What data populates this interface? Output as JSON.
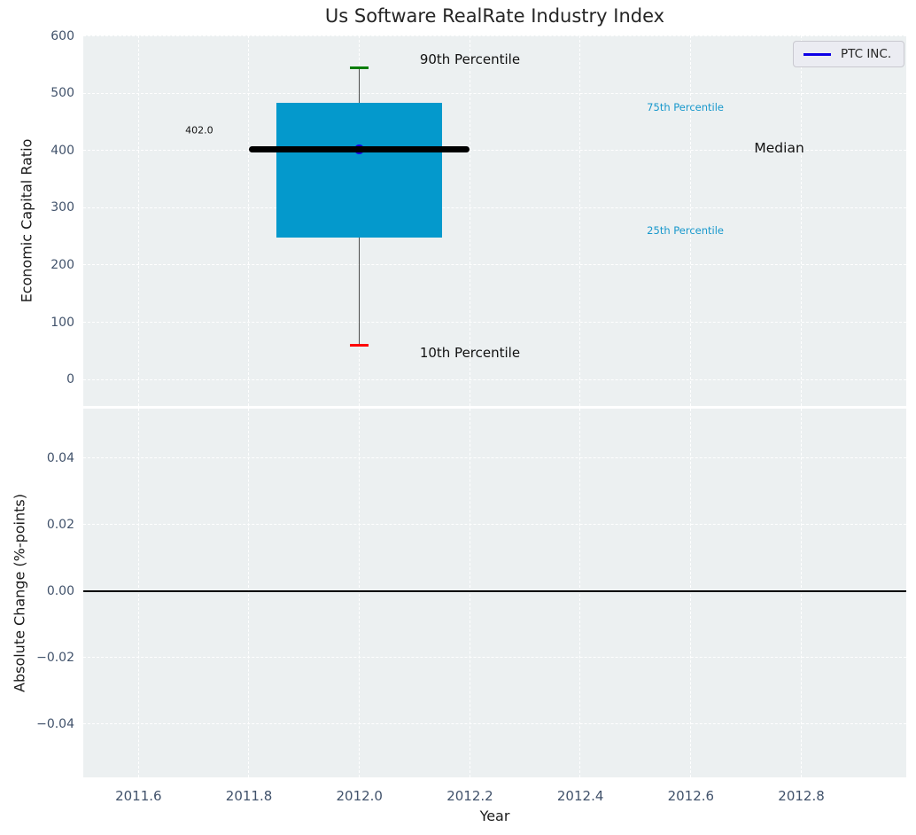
{
  "figure": {
    "title": "Us Software RealRate Industry Index",
    "xlabel": "Year",
    "legend": {
      "entries": [
        {
          "label": "PTC INC.",
          "line_color": "#0d00e6"
        }
      ]
    }
  },
  "colors": {
    "plot_background": "#ecf0f1",
    "gridline": "#ffffff",
    "box_fill": "#0499cc",
    "median_line": "#000000",
    "whisker": "#4d4d4d",
    "upper_cap": "#007d00",
    "lower_cap": "#fe0000",
    "company_marker": "#1500e0",
    "tick_label": "#41526b",
    "axis_label": "#1a1a1a",
    "zero_line": "#000000",
    "percentile_label_blue": "#1898cc",
    "annotation_black": "#111111"
  },
  "chart_data": [
    {
      "type": "box",
      "title": "Us Software RealRate Industry Index",
      "ylabel": "Economic Capital Ratio",
      "xlabel": "Year",
      "xlim": [
        2011.5,
        2012.99
      ],
      "ylim": [
        -46,
        601
      ],
      "grid": true,
      "legend_position": "upper right",
      "box": {
        "x": 2012.0,
        "p10": 60,
        "p25": 248,
        "median": 402,
        "p75": 483,
        "p90": 545,
        "box_half_width": 0.15,
        "median_half_width": 0.2,
        "cap_half_width": 0.017
      },
      "series": [
        {
          "name": "PTC INC.",
          "x": [
            2012.0
          ],
          "values": [
            402
          ]
        }
      ],
      "yticks": [
        {
          "v": 0,
          "label": "0"
        },
        {
          "v": 100,
          "label": "100"
        },
        {
          "v": 200,
          "label": "200"
        },
        {
          "v": 300,
          "label": "300"
        },
        {
          "v": 400,
          "label": "400"
        },
        {
          "v": 500,
          "label": "500"
        },
        {
          "v": 600,
          "label": "600"
        }
      ],
      "xticks": [
        {
          "v": 2011.6,
          "label": "2011.6"
        },
        {
          "v": 2011.8,
          "label": "2011.8"
        },
        {
          "v": 2012.0,
          "label": "2012.0"
        },
        {
          "v": 2012.2,
          "label": "2012.2"
        },
        {
          "v": 2012.4,
          "label": "2012.4"
        },
        {
          "v": 2012.6,
          "label": "2012.6"
        },
        {
          "v": 2012.8,
          "label": "2012.8"
        }
      ],
      "annotations": [
        {
          "text": "402.0",
          "x": 2011.71,
          "y": 435,
          "color": "#111111",
          "size": 11
        },
        {
          "text": "90th Percentile",
          "x": 2012.2,
          "y": 559,
          "color": "#111111",
          "size": 15
        },
        {
          "text": "10th Percentile",
          "x": 2012.2,
          "y": 47,
          "color": "#111111",
          "size": 15
        },
        {
          "text": "75th Percentile",
          "x": 2012.59,
          "y": 476,
          "color": "#1898cc",
          "size": 11.5
        },
        {
          "text": "25th Percentile",
          "x": 2012.59,
          "y": 260,
          "color": "#1898cc",
          "size": 11.5
        },
        {
          "text": "Median",
          "x": 2012.76,
          "y": 404,
          "color": "#111111",
          "size": 15.5
        }
      ]
    },
    {
      "type": "line",
      "ylabel": "Absolute Change (%-points)",
      "xlabel": "Year",
      "xlim": [
        2011.5,
        2012.99
      ],
      "ylim": [
        -0.056,
        0.055
      ],
      "grid": true,
      "zero_line": 0.0,
      "series": [],
      "yticks": [
        {
          "v": -0.04,
          "label": "−0.04"
        },
        {
          "v": -0.02,
          "label": "−0.02"
        },
        {
          "v": 0,
          "label": "0.00"
        },
        {
          "v": 0.02,
          "label": "0.02"
        },
        {
          "v": 0.04,
          "label": "0.04"
        }
      ],
      "xticks": [
        {
          "v": 2011.6,
          "label": "2011.6"
        },
        {
          "v": 2011.8,
          "label": "2011.8"
        },
        {
          "v": 2012.0,
          "label": "2012.0"
        },
        {
          "v": 2012.2,
          "label": "2012.2"
        },
        {
          "v": 2012.4,
          "label": "2012.4"
        },
        {
          "v": 2012.6,
          "label": "2012.6"
        },
        {
          "v": 2012.8,
          "label": "2012.8"
        }
      ]
    }
  ]
}
